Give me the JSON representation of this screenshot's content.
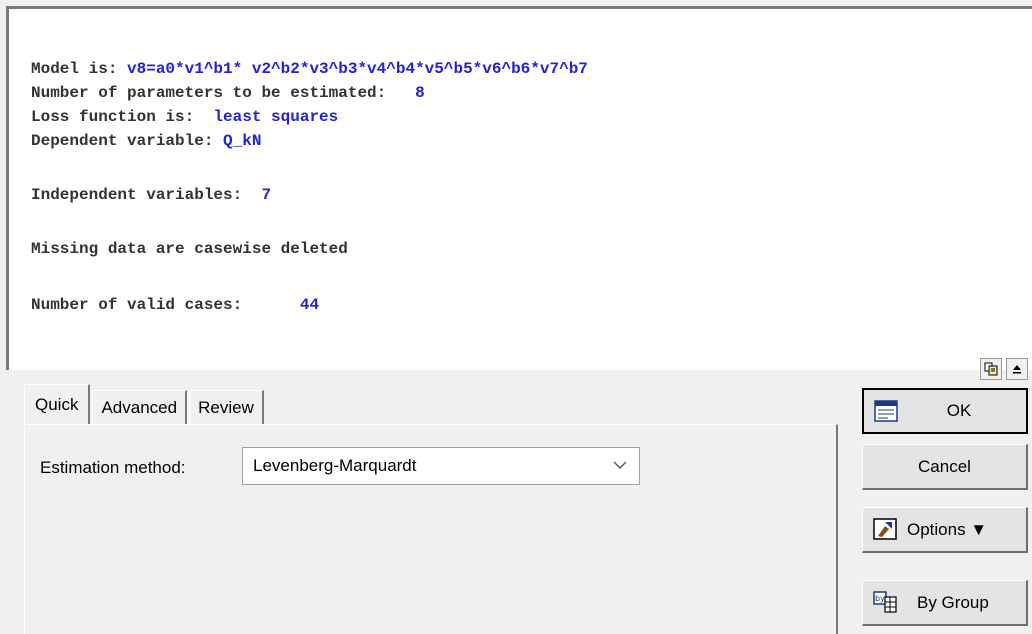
{
  "output": {
    "lines": {
      "model_label": "Model is: ",
      "model_value": "v8=a0*v1^b1* v2^b2*v3^b3*v4^b4*v5^b5*v6^b6*v7^b7",
      "params_label": "Number of parameters to be estimated:   ",
      "params_value": "8",
      "loss_label": "Loss function is:  ",
      "loss_value": "least squares",
      "dep_label": "Dependent variable: ",
      "dep_value": "Q_kN",
      "indep_label": "Independent variables:  ",
      "indep_value": "7",
      "missing_text": "Missing data are casewise deleted",
      "cases_label": "Number of valid cases:      ",
      "cases_value": "44"
    }
  },
  "tabs": [
    {
      "label": "Quick",
      "active": true
    },
    {
      "label": "Advanced",
      "active": false
    },
    {
      "label": "Review",
      "active": false
    }
  ],
  "quick": {
    "estimation_label": "Estimation method:",
    "estimation_value": "Levenberg-Marquardt"
  },
  "buttons": {
    "ok_label": "OK",
    "cancel_label": "Cancel",
    "options_label": "Options ▼",
    "by_group_label": "By Group"
  },
  "icons": {
    "copy": "copy-icon",
    "collapse": "collapse-icon",
    "ok": "ok-icon",
    "options": "options-icon",
    "by_group": "by-group-icon",
    "dropdown": "chevron-down-icon"
  }
}
